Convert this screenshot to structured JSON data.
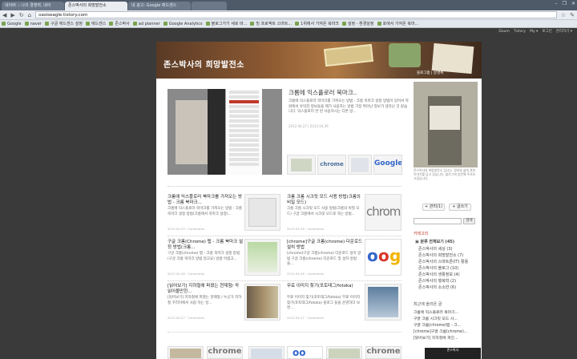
{
  "browser": {
    "tabs": [
      {
        "label": "네이버 :: 나의 경쟁력, 네이"
      },
      {
        "label": "존스박사의 희망발전소"
      },
      {
        "label": "내 광고: Google 애드센스"
      }
    ],
    "window_controls": [
      "–",
      "❐",
      "✕"
    ],
    "url": "oasiseagle.tistory.com",
    "bookmarks": [
      "Google",
      "naver",
      "구글 애드센스 설정",
      "애드센스",
      "존스박사",
      "ad planner",
      "Google Analytics",
      "블로그가기 새로 바...",
      "빙 프로젝트 스마트...",
      "1위에서 가져온 북마크",
      "설정 - 환경설정",
      "포에서 가져온 북마..."
    ]
  },
  "tistory_bar": [
    "Daum",
    "Tistory",
    "My ▾",
    "로그인",
    "관리하기 ▾"
  ],
  "blog": {
    "title": "존스박사의 희망발전소",
    "banner_menu": "블로그홈 | 방명록",
    "featured": {
      "title": "크롬에 익스플로러 북마크..",
      "body": "크롬에 익스플로러 북마크를 가져오는 방법 - 크롬 북마크 설정 방법이 있어서 학원에서 유익한 정보들을 제가 사용하는 방법 가장 뛰어난 정보가 생각난 것 같습니다. 익스플로러 한 번 사용하시는 다른 방...",
      "date": "2012.04.27 | 2012.04.29"
    },
    "posts": [
      {
        "title": "크롬에 익스플로러 북마크를 가져오는 방법 - 크롬 북마크...",
        "body": "크롬에 익스플로러 북마크를 가져오는 방법 - 크롬 북마크 설정 방법(크롬에서 북마크 설정)...",
        "date": "2012.04.29 · Comments"
      },
      {
        "title": "크롬 크롬 시크릿 모드 사용 방법(크롬의 비밀 모드)",
        "body": "크롬 크롬 시크릿 모드 사용 방법(크롬의 비밀 모드) 구글 크롬에서 시크릿 모드로 하는 방법...",
        "date": "2012.04.29 · Comments"
      },
      {
        "title": "구글 크롬(Chrome) 탭 - 크롬 북마크 설정 방법(크롬...",
        "body": "구글 크롬(chrome) 탭 - 크롬 북마크 설정 방법 (구글 크롬 북마크 방법 알고요) 방법 어렵고...",
        "date": "2012.04.28 · Comments"
      },
      {
        "title": "[chrome]구글 크롬(chrome) 다운로드 설치 방법",
        "body": "[chrome]구글 크롬(chrome) 다운로드 설치 방법 구글 크롬(chrome) 다운로드 및 설치 방법을...",
        "date": "2012.04.28 · Comments"
      },
      {
        "title": "[읽어보기] 지하철에 퍼졌는 현재형/ 꼭 읽어볼만한...",
        "body": "[읽어보기] 지하철에 퍼졌는 현재형 / 누군가 지하철 꾸러미에서 사람 하는 일...",
        "date": "2012.04.27 · Comments"
      },
      {
        "title": "무료 이미지 찾기(포토태그/fotoka)",
        "body": "무료 이미지 찾기(포토태그/fotoka) 무료 이미지 찾기(포토태그/fotoka) 블로그 들을 운영하다 보면...",
        "date": "2012.04.27 · Comments"
      }
    ],
    "thumb_labels": {
      "chrome": "chrome",
      "google": "Google"
    },
    "sidebar": {
      "desc": "존스박사의 희망발전소 입니다. 정보와 삶에 관한 이야기를 담고 있습니다. 블로그에 방문해 주셔서 고맙습니다.",
      "rss_label": "+ 관리(1)",
      "write_label": "+ 글쓰기",
      "search_btn": "검색",
      "category_head": "카테고리",
      "categories": [
        "▣ 분류 전체보기 (45)",
        "존스박사의 세상 (3)",
        "존스박사의 희망발전소 (7)",
        "존스박사의 스마트폰(IT) 활용",
        "존스박사의 블로그 (10)",
        "존스박사의 생활정보 (4)",
        "존스박사의 행복학 (2)",
        "존스박사의 소소한 (6)"
      ],
      "recent_head": "최근에 올라온 글",
      "recent": [
        "크롬에 익스플로러 북마크...",
        "구글 크롬 시크릿 모드 사...",
        "구글 크롬(chrome)탭 - 크...",
        "[chrome]구글 크롬(chrome)...",
        "[읽어보기] 지하철에 퍼진..."
      ]
    },
    "popup_text": "존스박사"
  }
}
